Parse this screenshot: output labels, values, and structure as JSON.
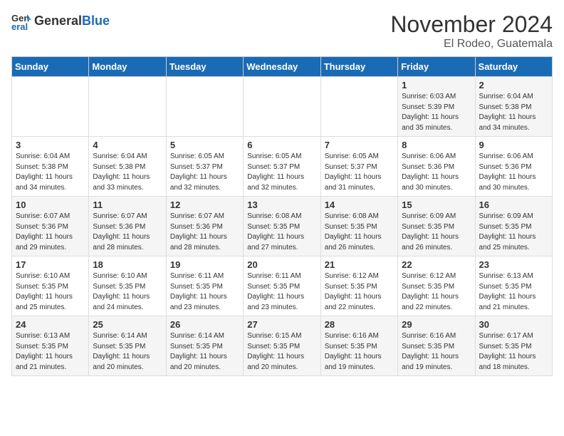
{
  "header": {
    "logo_line1": "General",
    "logo_line2": "Blue",
    "month": "November 2024",
    "location": "El Rodeo, Guatemala"
  },
  "days_of_week": [
    "Sunday",
    "Monday",
    "Tuesday",
    "Wednesday",
    "Thursday",
    "Friday",
    "Saturday"
  ],
  "weeks": [
    [
      {
        "day": "",
        "info": ""
      },
      {
        "day": "",
        "info": ""
      },
      {
        "day": "",
        "info": ""
      },
      {
        "day": "",
        "info": ""
      },
      {
        "day": "",
        "info": ""
      },
      {
        "day": "1",
        "info": "Sunrise: 6:03 AM\nSunset: 5:39 PM\nDaylight: 11 hours\nand 35 minutes."
      },
      {
        "day": "2",
        "info": "Sunrise: 6:04 AM\nSunset: 5:38 PM\nDaylight: 11 hours\nand 34 minutes."
      }
    ],
    [
      {
        "day": "3",
        "info": "Sunrise: 6:04 AM\nSunset: 5:38 PM\nDaylight: 11 hours\nand 34 minutes."
      },
      {
        "day": "4",
        "info": "Sunrise: 6:04 AM\nSunset: 5:38 PM\nDaylight: 11 hours\nand 33 minutes."
      },
      {
        "day": "5",
        "info": "Sunrise: 6:05 AM\nSunset: 5:37 PM\nDaylight: 11 hours\nand 32 minutes."
      },
      {
        "day": "6",
        "info": "Sunrise: 6:05 AM\nSunset: 5:37 PM\nDaylight: 11 hours\nand 32 minutes."
      },
      {
        "day": "7",
        "info": "Sunrise: 6:05 AM\nSunset: 5:37 PM\nDaylight: 11 hours\nand 31 minutes."
      },
      {
        "day": "8",
        "info": "Sunrise: 6:06 AM\nSunset: 5:36 PM\nDaylight: 11 hours\nand 30 minutes."
      },
      {
        "day": "9",
        "info": "Sunrise: 6:06 AM\nSunset: 5:36 PM\nDaylight: 11 hours\nand 30 minutes."
      }
    ],
    [
      {
        "day": "10",
        "info": "Sunrise: 6:07 AM\nSunset: 5:36 PM\nDaylight: 11 hours\nand 29 minutes."
      },
      {
        "day": "11",
        "info": "Sunrise: 6:07 AM\nSunset: 5:36 PM\nDaylight: 11 hours\nand 28 minutes."
      },
      {
        "day": "12",
        "info": "Sunrise: 6:07 AM\nSunset: 5:36 PM\nDaylight: 11 hours\nand 28 minutes."
      },
      {
        "day": "13",
        "info": "Sunrise: 6:08 AM\nSunset: 5:35 PM\nDaylight: 11 hours\nand 27 minutes."
      },
      {
        "day": "14",
        "info": "Sunrise: 6:08 AM\nSunset: 5:35 PM\nDaylight: 11 hours\nand 26 minutes."
      },
      {
        "day": "15",
        "info": "Sunrise: 6:09 AM\nSunset: 5:35 PM\nDaylight: 11 hours\nand 26 minutes."
      },
      {
        "day": "16",
        "info": "Sunrise: 6:09 AM\nSunset: 5:35 PM\nDaylight: 11 hours\nand 25 minutes."
      }
    ],
    [
      {
        "day": "17",
        "info": "Sunrise: 6:10 AM\nSunset: 5:35 PM\nDaylight: 11 hours\nand 25 minutes."
      },
      {
        "day": "18",
        "info": "Sunrise: 6:10 AM\nSunset: 5:35 PM\nDaylight: 11 hours\nand 24 minutes."
      },
      {
        "day": "19",
        "info": "Sunrise: 6:11 AM\nSunset: 5:35 PM\nDaylight: 11 hours\nand 23 minutes."
      },
      {
        "day": "20",
        "info": "Sunrise: 6:11 AM\nSunset: 5:35 PM\nDaylight: 11 hours\nand 23 minutes."
      },
      {
        "day": "21",
        "info": "Sunrise: 6:12 AM\nSunset: 5:35 PM\nDaylight: 11 hours\nand 22 minutes."
      },
      {
        "day": "22",
        "info": "Sunrise: 6:12 AM\nSunset: 5:35 PM\nDaylight: 11 hours\nand 22 minutes."
      },
      {
        "day": "23",
        "info": "Sunrise: 6:13 AM\nSunset: 5:35 PM\nDaylight: 11 hours\nand 21 minutes."
      }
    ],
    [
      {
        "day": "24",
        "info": "Sunrise: 6:13 AM\nSunset: 5:35 PM\nDaylight: 11 hours\nand 21 minutes."
      },
      {
        "day": "25",
        "info": "Sunrise: 6:14 AM\nSunset: 5:35 PM\nDaylight: 11 hours\nand 20 minutes."
      },
      {
        "day": "26",
        "info": "Sunrise: 6:14 AM\nSunset: 5:35 PM\nDaylight: 11 hours\nand 20 minutes."
      },
      {
        "day": "27",
        "info": "Sunrise: 6:15 AM\nSunset: 5:35 PM\nDaylight: 11 hours\nand 20 minutes."
      },
      {
        "day": "28",
        "info": "Sunrise: 6:16 AM\nSunset: 5:35 PM\nDaylight: 11 hours\nand 19 minutes."
      },
      {
        "day": "29",
        "info": "Sunrise: 6:16 AM\nSunset: 5:35 PM\nDaylight: 11 hours\nand 19 minutes."
      },
      {
        "day": "30",
        "info": "Sunrise: 6:17 AM\nSunset: 5:35 PM\nDaylight: 11 hours\nand 18 minutes."
      }
    ]
  ]
}
